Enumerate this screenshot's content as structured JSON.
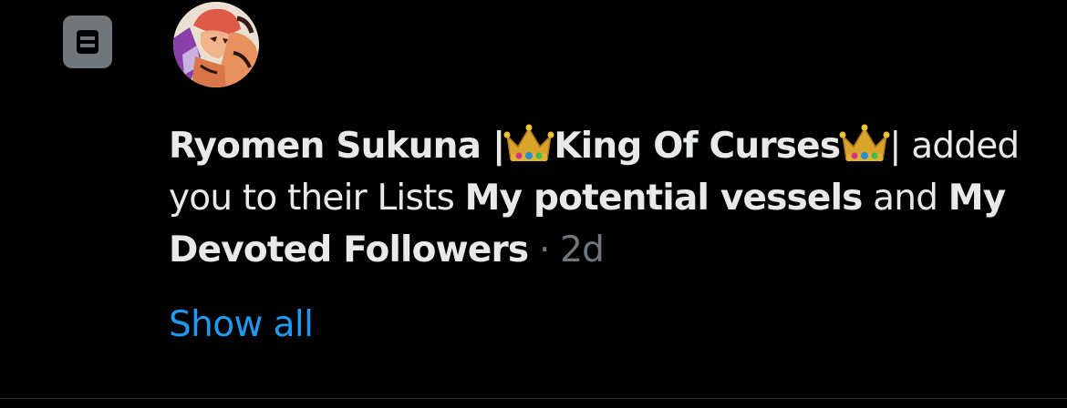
{
  "notification": {
    "actor_name": "Ryomen Sukuna |",
    "actor_title": "King Of Curses",
    "actor_suffix": "| ",
    "action_text": "added you to their Lists ",
    "list_one": "My potential vessels",
    "conjunction": " and ",
    "list_two": "My Devoted Followers",
    "separator": " · ",
    "time": "2d",
    "show_all_label": "Show all"
  },
  "icons": {
    "type_icon": "list-icon",
    "emoji": "crown-icon"
  },
  "colors": {
    "background": "#000000",
    "text": "#e7e9ea",
    "muted": "#71767b",
    "link": "#1d9bf0",
    "divider": "#2f3336"
  }
}
